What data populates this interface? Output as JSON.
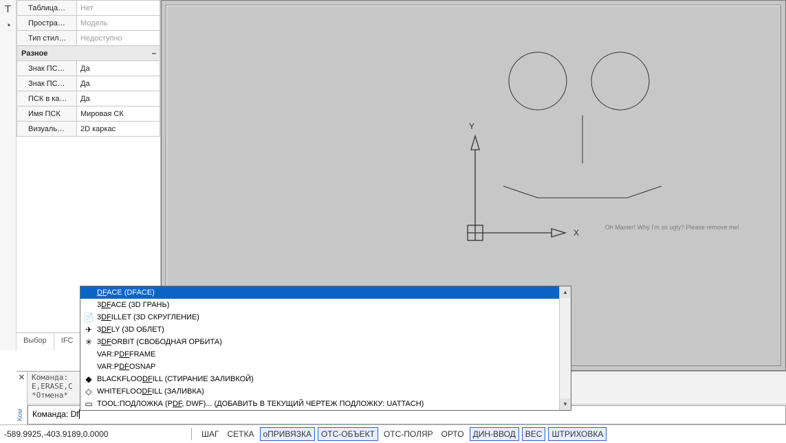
{
  "leftIcons": [
    "T",
    "◔"
  ],
  "props": {
    "top": [
      {
        "label": "Таблица…",
        "value": "Нет",
        "dim": true
      },
      {
        "label": "Простра…",
        "value": "Модель",
        "dim": true
      },
      {
        "label": "Тип стил…",
        "value": "Недоступно",
        "dim": true
      }
    ],
    "sectionTitle": "Разное",
    "rows": [
      {
        "label": "Знак ПС…",
        "value": "Да"
      },
      {
        "label": "Знак ПС…",
        "value": "Да"
      },
      {
        "label": "ПСК в ка…",
        "value": "Да"
      },
      {
        "label": "Имя ПСК",
        "value": "Мировая СК"
      },
      {
        "label": "Визуаль…",
        "value": "2D каркас"
      }
    ],
    "tabs": [
      "Выбор",
      "IFC"
    ]
  },
  "axis": {
    "x": "X",
    "y": "Y"
  },
  "canvasNote": "Oh Master! Why I'm so ugly? Please remove me!",
  "ac": {
    "items": [
      {
        "icon": "",
        "html": "<u>DF</u>ACE (DFACE)",
        "sel": true
      },
      {
        "icon": "",
        "html": "3<u>DF</u>ACE (3D ГРАНЬ)"
      },
      {
        "icon": "📄",
        "html": "3<u>DF</u>ILLET (3D СКРУГЛЕНИЕ)"
      },
      {
        "icon": "✈",
        "html": "3<u>DF</u>LY (3D ОБЛЕТ)"
      },
      {
        "icon": "✳",
        "html": "3<u>DF</u>ORBIT (СВОБОДНАЯ ОРБИТА)"
      },
      {
        "icon": "",
        "html": "VAR:P<u>DF</u>FRAME"
      },
      {
        "icon": "",
        "html": "VAR:P<u>DF</u>OSNAP"
      },
      {
        "icon": "◆",
        "html": "BLACKFLOO<u>DF</u>ILL (СТИРАНИЕ ЗАЛИВКОЙ)"
      },
      {
        "icon": "◇",
        "html": "WHITEFLOO<u>DF</u>ILL (ЗАЛИВКА)"
      },
      {
        "icon": "▭",
        "html": "TOOL:ПОДЛОЖКА (P<u>DF</u>, DWF)... (ДОБАВИТЬ В ТЕКУЩИЙ ЧЕРТЕЖ ПОДЛОЖКУ: UATTACH)"
      }
    ]
  },
  "cmdHandle": {
    "closeLabel": "✕",
    "vertLabel": "Ком"
  },
  "cmdHist": "Команда:\nE,ERASE,С\n*Отмена*",
  "cmdPrompt": "Команда: ",
  "cmdInput": "Df",
  "status": {
    "coords": "-589.9925,-403.9189,0.0000",
    "buttons": [
      {
        "label": "ШАГ",
        "on": false
      },
      {
        "label": "СЕТКА",
        "on": false
      },
      {
        "label": "оПРИВЯЗКА",
        "on": true
      },
      {
        "label": "ОТС-ОБЪЕКТ",
        "on": true
      },
      {
        "label": "ОТС-ПОЛЯР",
        "on": false
      },
      {
        "label": "ОРТО",
        "on": false
      },
      {
        "label": "ДИН-ВВОД",
        "on": true
      },
      {
        "label": "ВЕС",
        "on": true
      },
      {
        "label": "ШТРИХОВКА",
        "on": true
      }
    ]
  }
}
